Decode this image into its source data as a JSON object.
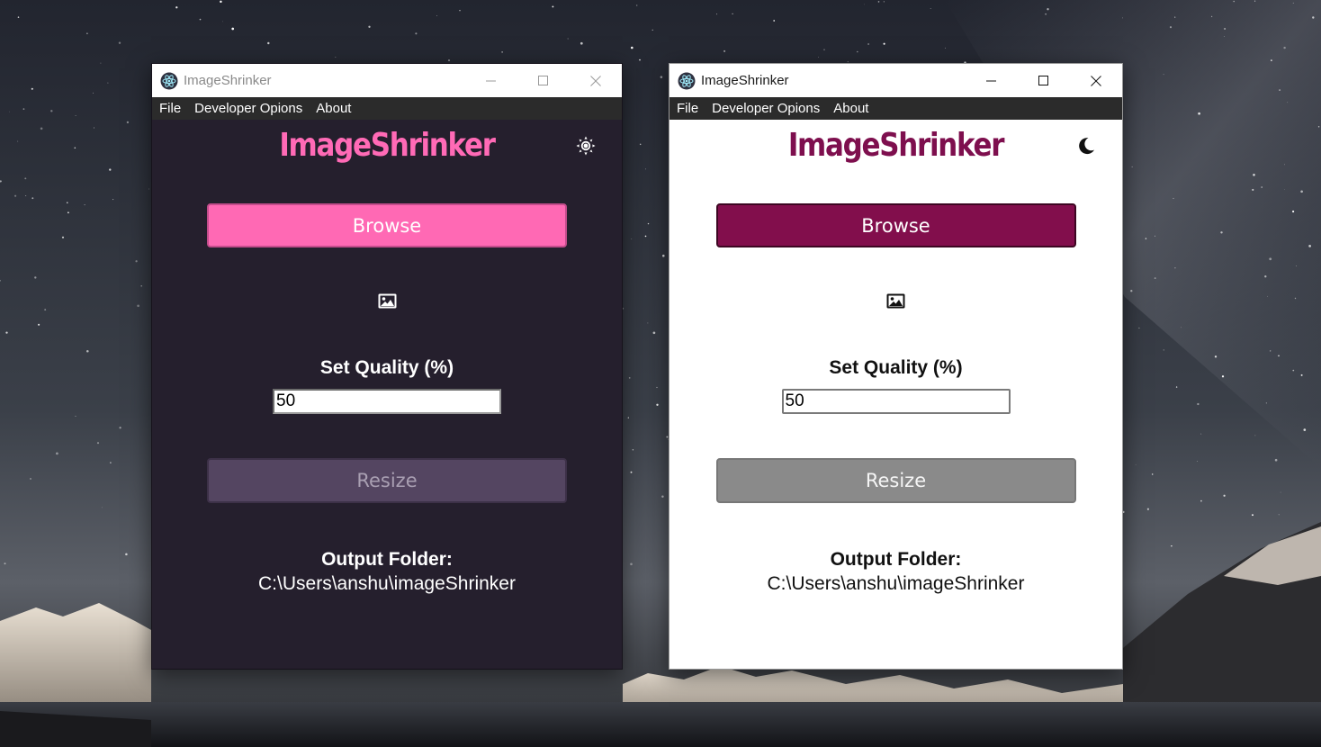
{
  "desktop": {
    "wallpaper_icon": "starry-night-mountain-icon"
  },
  "windows": {
    "dark": {
      "title": "ImageShrinker",
      "menu": [
        "File",
        "Developer Opions",
        "About"
      ],
      "app_title": "ImageShrinker",
      "theme_toggle_icon": "sun-icon",
      "browse_label": "Browse",
      "preview_icon": "image-icon",
      "quality_label": "Set Quality (%)",
      "quality_value": "50",
      "resize_label": "Resize",
      "output_label": "Output Folder:",
      "output_path": "C:\\Users\\anshu\\imageShrinker",
      "colors": {
        "background": "#251f2d",
        "accent": "#ff69b4",
        "resize_disabled": "#544561"
      }
    },
    "light": {
      "title": "ImageShrinker",
      "menu": [
        "File",
        "Developer Opions",
        "About"
      ],
      "app_title": "ImageShrinker",
      "theme_toggle_icon": "moon-icon",
      "browse_label": "Browse",
      "preview_icon": "image-icon",
      "quality_label": "Set Quality (%)",
      "quality_value": "50",
      "resize_label": "Resize",
      "output_label": "Output Folder:",
      "output_path": "C:\\Users\\anshu\\imageShrinker",
      "colors": {
        "background": "#ffffff",
        "accent": "#820e4c",
        "resize_disabled": "#8a8a8a"
      }
    }
  },
  "window_controls": {
    "minimize_icon": "minimize-icon",
    "maximize_icon": "maximize-icon",
    "close_icon": "close-icon"
  }
}
